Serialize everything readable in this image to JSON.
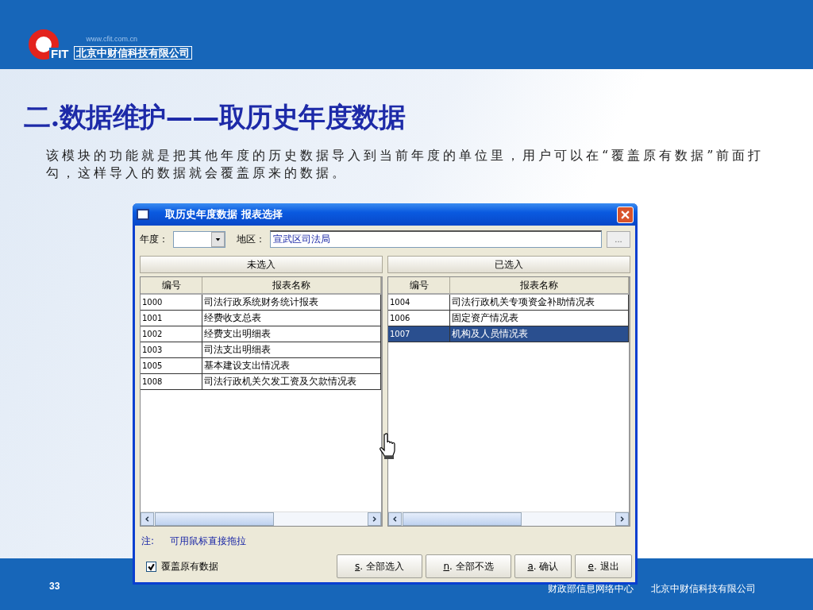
{
  "logo": {
    "mark": "FIT",
    "url": "www.cfit.com.cn",
    "company": "北京中财信科技有限公司"
  },
  "title": "二.数据维护——取历史年度数据",
  "description": "该模块的功能就是把其他年度的历史数据导入到当前年度的单位里，用户可以在“覆盖原有数据”前面打勾，这样导入的数据就会覆盖原来的数据。",
  "dialog": {
    "title": "取历史年度数据  报表选择",
    "year": {
      "label": "年度："
    },
    "region": {
      "label": "地区：",
      "value": "宣武区司法局",
      "browse": "..."
    },
    "panels": [
      {
        "heading": "未选入",
        "columns": [
          "编号",
          "报表名称"
        ],
        "rows": [
          {
            "code": "1000",
            "name": "司法行政系统财务统计报表",
            "selected": false
          },
          {
            "code": "1001",
            "name": "经费收支总表",
            "selected": false
          },
          {
            "code": "1002",
            "name": "经费支出明细表",
            "selected": false
          },
          {
            "code": "1003",
            "name": "司法支出明细表",
            "selected": false
          },
          {
            "code": "1005",
            "name": "基本建设支出情况表",
            "selected": false
          },
          {
            "code": "1008",
            "name": "司法行政机关欠发工资及欠款情况表",
            "selected": false
          }
        ]
      },
      {
        "heading": "已选入",
        "columns": [
          "编号",
          "报表名称"
        ],
        "rows": [
          {
            "code": "1004",
            "name": "司法行政机关专项资金补助情况表",
            "selected": false
          },
          {
            "code": "1006",
            "name": "固定资产情况表",
            "selected": false
          },
          {
            "code": "1007",
            "name": "机构及人员情况表",
            "selected": true
          }
        ]
      }
    ],
    "note": {
      "label": "注:",
      "text": "可用鼠标直接拖拉"
    },
    "overwrite": {
      "label": "覆盖原有数据",
      "checked": true
    },
    "buttons": [
      "s. 全部选入",
      "n. 全部不选",
      "a. 确认",
      "e. 退出"
    ]
  },
  "page_number": "33",
  "footer": [
    "财政部信息网络中心",
    "北京中财信科技有限公司"
  ]
}
